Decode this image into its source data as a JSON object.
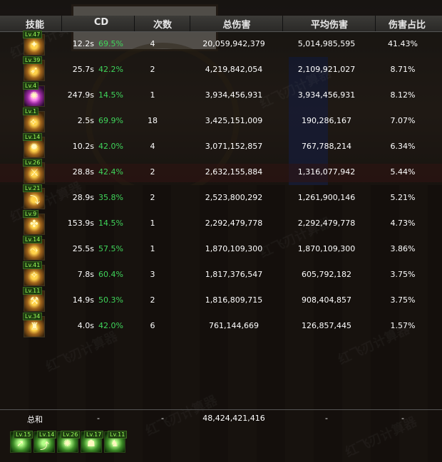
{
  "columns": [
    "技能",
    "CD",
    "次数",
    "总伤害",
    "平均伤害",
    "伤害占比"
  ],
  "rows": [
    {
      "level": "Lv.47",
      "glyph": "✦",
      "cd": "12.2s",
      "cd_pct": "69.5%",
      "count": "4",
      "total": "20,059,942,379",
      "avg": "5,014,985,595",
      "share": "41.43%"
    },
    {
      "level": "Lv.39",
      "glyph": "➶",
      "cd": "25.7s",
      "cd_pct": "42.2%",
      "count": "2",
      "total": "4,219,842,054",
      "avg": "2,109,921,027",
      "share": "8.71%"
    },
    {
      "level": "Lv.4",
      "glyph": "✺",
      "cd": "247.9s",
      "cd_pct": "14.5%",
      "count": "1",
      "total": "3,934,456,931",
      "avg": "3,934,456,931",
      "share": "8.12%"
    },
    {
      "level": "Lv.1",
      "glyph": "⟡",
      "cd": "2.5s",
      "cd_pct": "69.9%",
      "count": "18",
      "total": "3,425,151,009",
      "avg": "190,286,167",
      "share": "7.07%"
    },
    {
      "level": "Lv.14",
      "glyph": "✹",
      "cd": "10.2s",
      "cd_pct": "42.0%",
      "count": "4",
      "total": "3,071,152,857",
      "avg": "767,788,214",
      "share": "6.34%"
    },
    {
      "level": "Lv.26",
      "glyph": "⚔",
      "cd": "28.8s",
      "cd_pct": "42.4%",
      "count": "2",
      "total": "2,632,155,884",
      "avg": "1,316,077,942",
      "share": "5.44%"
    },
    {
      "level": "Lv.21",
      "glyph": "⤵",
      "cd": "28.9s",
      "cd_pct": "35.8%",
      "count": "2",
      "total": "2,523,800,292",
      "avg": "1,261,900,146",
      "share": "5.21%"
    },
    {
      "level": "Lv.9",
      "glyph": "✤",
      "cd": "153.9s",
      "cd_pct": "14.5%",
      "count": "1",
      "total": "2,292,479,778",
      "avg": "2,292,479,778",
      "share": "4.73%"
    },
    {
      "level": "Lv.14",
      "glyph": "⤳",
      "cd": "25.5s",
      "cd_pct": "57.5%",
      "count": "1",
      "total": "1,870,109,300",
      "avg": "1,870,109,300",
      "share": "3.86%"
    },
    {
      "level": "Lv.41",
      "glyph": "✧",
      "cd": "7.8s",
      "cd_pct": "60.4%",
      "count": "3",
      "total": "1,817,376,547",
      "avg": "605,792,182",
      "share": "3.75%"
    },
    {
      "level": "Lv.11",
      "glyph": "⚒",
      "cd": "14.9s",
      "cd_pct": "50.3%",
      "count": "2",
      "total": "1,816,809,715",
      "avg": "908,404,857",
      "share": "3.75%"
    },
    {
      "level": "Lv.34",
      "glyph": "♜",
      "cd": "4.0s",
      "cd_pct": "42.0%",
      "count": "6",
      "total": "761,144,669",
      "avg": "126,857,445",
      "share": "1.57%"
    }
  ],
  "summary": {
    "label": "总和",
    "cd": "-",
    "count": "-",
    "total": "48,424,421,416",
    "avg": "-",
    "share": "-"
  },
  "buffs": [
    {
      "level": "Lv.15",
      "glyph": "➚"
    },
    {
      "level": "Lv.14",
      "glyph": "⤴"
    },
    {
      "level": "Lv.26",
      "glyph": "✺"
    },
    {
      "level": "Lv.17",
      "glyph": "☗"
    },
    {
      "level": "Lv.11",
      "glyph": "♞"
    }
  ],
  "watermark": "红飞刃计算器",
  "colors": {
    "header_bg": "#33322f",
    "cd_percent": "#3fd45a",
    "level_badge": "#9cff5a"
  }
}
